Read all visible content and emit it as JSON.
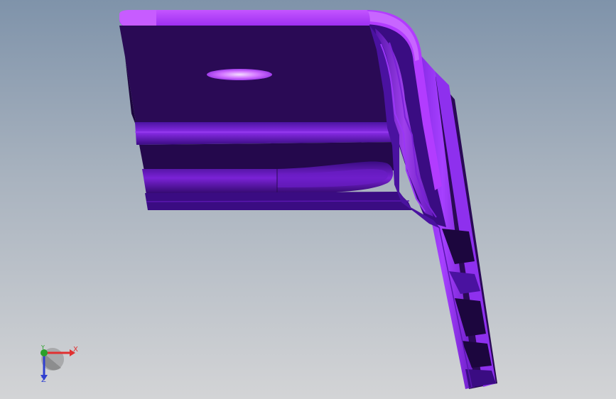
{
  "viewport": {
    "background_top": "#7f93aa",
    "background_bottom": "#d3d4d6"
  },
  "model": {
    "part_color_light": "#b23cff",
    "part_color_mid": "#7a22d6",
    "part_color_dark": "#2a0a55",
    "part_color_darkest": "#1c063e",
    "hole_highlight": "#e8c8ff"
  },
  "triad": {
    "x_label": "X",
    "y_label": "Y",
    "z_label": "Z",
    "x_color": "#e03030",
    "y_color": "#2aa02a",
    "z_color": "#3040d0"
  }
}
